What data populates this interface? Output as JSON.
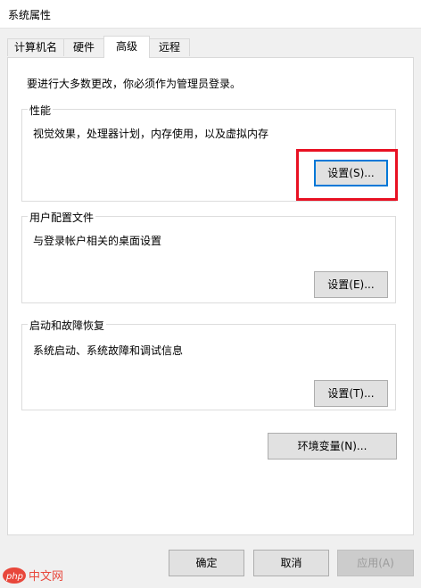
{
  "window": {
    "title": "系统属性"
  },
  "tabs": [
    {
      "label": "计算机名"
    },
    {
      "label": "硬件"
    },
    {
      "label": "高级",
      "active": true
    },
    {
      "label": "远程"
    }
  ],
  "advanced": {
    "intro": "要进行大多数更改，你必须作为管理员登录。",
    "performance": {
      "label": "性能",
      "description": "视觉效果，处理器计划，内存使用，以及虚拟内存",
      "button": "设置(S)..."
    },
    "user_profiles": {
      "label": "用户配置文件",
      "description": "与登录帐户相关的桌面设置",
      "button": "设置(E)..."
    },
    "startup_recovery": {
      "label": "启动和故障恢复",
      "description": "系统启动、系统故障和调试信息",
      "button": "设置(T)..."
    },
    "env_button": "环境变量(N)..."
  },
  "footer": {
    "ok": "确定",
    "cancel": "取消",
    "apply": "应用(A)"
  },
  "watermark": {
    "text": "php 中文网"
  },
  "colors": {
    "highlight": "#e81123",
    "focus": "#0078d7"
  }
}
